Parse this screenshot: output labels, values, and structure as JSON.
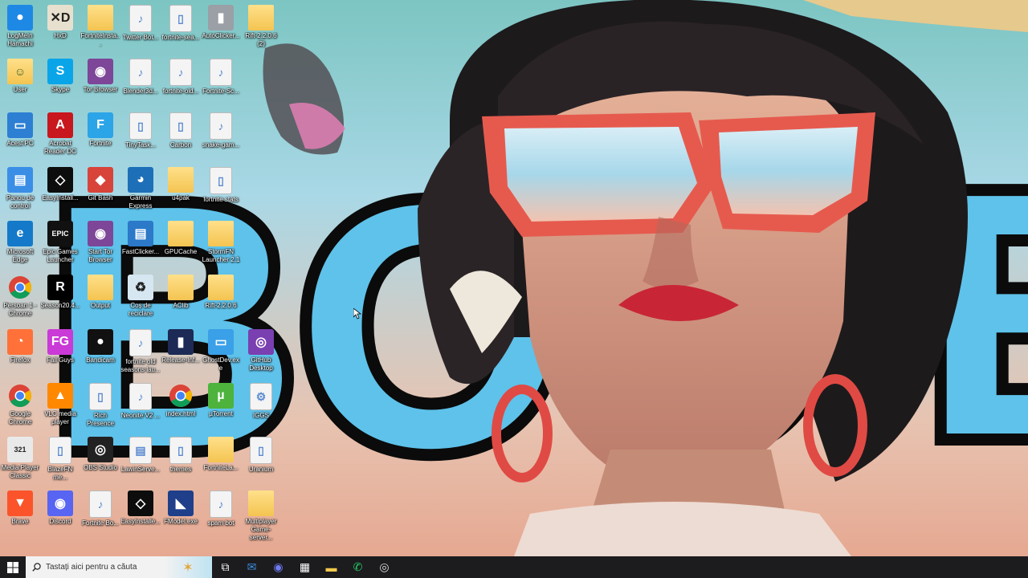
{
  "wallpaper": {
    "text_letters": "BOO",
    "text_letters_right": "E"
  },
  "desktop": {
    "icons": [
      {
        "label": "LogMeIn Hamachi",
        "icon": "logmein-hamachi-icon",
        "kind": "app",
        "color": "#1e88e5",
        "glyph": "●"
      },
      {
        "label": "HxD",
        "icon": "hxd-icon",
        "kind": "app",
        "color": "#e8e0cf",
        "glyph": "✕D"
      },
      {
        "label": "FortniteInsta...",
        "icon": "folder-icon",
        "kind": "folder",
        "glyph": ""
      },
      {
        "label": "Twitter Bot...",
        "icon": "document-icon",
        "kind": "doc",
        "glyph": "♪"
      },
      {
        "label": "fortnite-sea...",
        "icon": "document-icon",
        "kind": "doc",
        "glyph": "▯"
      },
      {
        "label": "AutoClicker...",
        "icon": "mouse-icon",
        "kind": "app",
        "color": "#9aa0a6",
        "glyph": "▮"
      },
      {
        "label": "Rift-2.2.0.6 (2)",
        "icon": "folder-icon",
        "kind": "folder",
        "glyph": ""
      },
      {
        "label": "User",
        "icon": "user-folder-icon",
        "kind": "folder",
        "glyph": "☺"
      },
      {
        "label": "Skype",
        "icon": "skype-icon",
        "kind": "app",
        "color": "#0aa5e8",
        "glyph": "S"
      },
      {
        "label": "Tor Browser",
        "icon": "tor-browser-icon",
        "kind": "app",
        "color": "#7d4698",
        "glyph": "◉"
      },
      {
        "label": "Blender3d...",
        "icon": "document-icon",
        "kind": "doc",
        "glyph": "♪"
      },
      {
        "label": "fortnite-old...",
        "icon": "document-icon",
        "kind": "doc",
        "glyph": "♪"
      },
      {
        "label": "Fortnite-Sc...",
        "icon": "document-icon",
        "kind": "doc",
        "glyph": "♪"
      },
      {
        "label": "Acest PC",
        "icon": "computer-icon",
        "kind": "app",
        "color": "#2d7fd3",
        "glyph": "▭"
      },
      {
        "label": "Acrobat Reader DC",
        "icon": "acrobat-reader-icon",
        "kind": "app",
        "color": "#c8171e",
        "glyph": "A"
      },
      {
        "label": "Fortnite",
        "icon": "fortnite-icon",
        "kind": "app",
        "color": "#2ba4e8",
        "glyph": "F"
      },
      {
        "label": "TinyTask...",
        "icon": "document-icon",
        "kind": "doc",
        "glyph": "▯"
      },
      {
        "label": "Carbon",
        "icon": "document-icon",
        "kind": "doc",
        "glyph": "▯"
      },
      {
        "label": "snake-gam...",
        "icon": "document-icon",
        "kind": "doc",
        "glyph": "♪"
      },
      {
        "label": "Panou de control",
        "icon": "control-panel-icon",
        "kind": "app",
        "color": "#3a8ee6",
        "glyph": "▤"
      },
      {
        "label": "EasyInstall...",
        "icon": "easyinstaller-icon",
        "kind": "app",
        "color": "#0d0d0d",
        "glyph": "◇"
      },
      {
        "label": "Git Bash",
        "icon": "git-bash-icon",
        "kind": "app",
        "color": "#d8443a",
        "glyph": "◆"
      },
      {
        "label": "Garmin Express",
        "icon": "garmin-express-icon",
        "kind": "app",
        "color": "#1d6fb8",
        "glyph": "◕"
      },
      {
        "label": "u4pak",
        "icon": "folder-icon",
        "kind": "folder",
        "glyph": ""
      },
      {
        "label": "fortnite stats",
        "icon": "document-icon",
        "kind": "doc",
        "glyph": "▯"
      },
      {
        "label": "Microsoft Edge",
        "icon": "edge-icon",
        "kind": "app",
        "color": "#1479c9",
        "glyph": "e"
      },
      {
        "label": "Epic Games Launcher",
        "icon": "epic-games-icon",
        "kind": "app",
        "color": "#111",
        "glyph": "EPIC"
      },
      {
        "label": "Start Tor Browser",
        "icon": "tor-browser-icon",
        "kind": "app",
        "color": "#7d4698",
        "glyph": "◉"
      },
      {
        "label": "FastClicker...",
        "icon": "fastclicker-icon",
        "kind": "app",
        "color": "#2b79c8",
        "glyph": "▤"
      },
      {
        "label": "GPUCache",
        "icon": "folder-icon",
        "kind": "folder",
        "glyph": ""
      },
      {
        "label": "StormFN Launcher 2.1",
        "icon": "folder-icon",
        "kind": "folder",
        "glyph": ""
      },
      {
        "label": "Persoan 1 - Chrome",
        "icon": "chrome-icon",
        "kind": "chrome",
        "glyph": ""
      },
      {
        "label": "Season20.4...",
        "icon": "season-icon",
        "kind": "app",
        "color": "#000",
        "glyph": "R"
      },
      {
        "label": "Output",
        "icon": "folder-icon",
        "kind": "folder",
        "glyph": ""
      },
      {
        "label": "Coș de reciclare",
        "icon": "recycle-bin-icon",
        "kind": "app",
        "color": "#d6e7f2",
        "glyph": "♻"
      },
      {
        "label": "AClib",
        "icon": "folder-icon",
        "kind": "folder",
        "glyph": ""
      },
      {
        "label": "Rift-2.2.0.6",
        "icon": "folder-icon",
        "kind": "folder",
        "glyph": ""
      },
      {
        "label": "Firefox",
        "icon": "firefox-icon",
        "kind": "app",
        "color": "#ff7139",
        "glyph": "◔"
      },
      {
        "label": "Fall Guys",
        "icon": "fall-guys-icon",
        "kind": "app",
        "color": "#c93ad6",
        "glyph": "FG"
      },
      {
        "label": "Bandicam",
        "icon": "bandicam-icon",
        "kind": "app",
        "color": "#111",
        "glyph": "●"
      },
      {
        "label": "fortnite old seasons lau...",
        "icon": "document-icon",
        "kind": "doc",
        "glyph": "♪"
      },
      {
        "label": "Release-Inf...",
        "icon": "release-icon",
        "kind": "app",
        "color": "#1c2a55",
        "glyph": "▮"
      },
      {
        "label": "GhostDev.exe",
        "icon": "ghostdev-icon",
        "kind": "app",
        "color": "#3aa0e8",
        "glyph": "▭"
      },
      {
        "label": "GitHub Desktop",
        "icon": "github-desktop-icon",
        "kind": "app",
        "color": "#7a3fb0",
        "glyph": "◎"
      },
      {
        "label": "Google Chrome",
        "icon": "chrome-icon",
        "kind": "chrome",
        "glyph": ""
      },
      {
        "label": "VLC media player",
        "icon": "vlc-icon",
        "kind": "app",
        "color": "#ff8800",
        "glyph": "▲"
      },
      {
        "label": "Rich Presence",
        "icon": "document-icon",
        "kind": "doc",
        "glyph": "▯"
      },
      {
        "label": "Neonite V2 ...",
        "icon": "document-icon",
        "kind": "doc",
        "glyph": "♪"
      },
      {
        "label": "index.html",
        "icon": "chrome-icon",
        "kind": "chrome",
        "glyph": ""
      },
      {
        "label": "µTorrent",
        "icon": "utorrent-icon",
        "kind": "app",
        "color": "#4db33d",
        "glyph": "µ"
      },
      {
        "label": "IGGS",
        "icon": "document-icon",
        "kind": "doc",
        "glyph": "⚙"
      },
      {
        "label": "Media Player Classic",
        "icon": "media-player-classic-icon",
        "kind": "app",
        "color": "#e9e9e9",
        "glyph": "321"
      },
      {
        "label": "BlazeFN me...",
        "icon": "document-icon",
        "kind": "doc",
        "glyph": "▯"
      },
      {
        "label": "OBS Studio",
        "icon": "obs-studio-icon",
        "kind": "app",
        "color": "#222",
        "glyph": "◎"
      },
      {
        "label": "LawinServe...",
        "icon": "document-icon",
        "kind": "doc",
        "glyph": "▤"
      },
      {
        "label": "themes",
        "icon": "document-icon",
        "kind": "doc",
        "glyph": "▯"
      },
      {
        "label": "FortniteLa...",
        "icon": "folder-icon",
        "kind": "folder",
        "glyph": ""
      },
      {
        "label": "Uranium",
        "icon": "document-icon",
        "kind": "doc",
        "glyph": "▯"
      },
      {
        "label": "Brave",
        "icon": "brave-icon",
        "kind": "app",
        "color": "#fb542b",
        "glyph": "▼"
      },
      {
        "label": "Discord",
        "icon": "discord-icon",
        "kind": "app",
        "color": "#5865f2",
        "glyph": "◉"
      },
      {
        "label": "Fortnite Bo...",
        "icon": "document-icon",
        "kind": "doc",
        "glyph": "♪"
      },
      {
        "label": "EasyInstalle...",
        "icon": "easyinstaller-icon",
        "kind": "app",
        "color": "#0d0d0d",
        "glyph": "◇"
      },
      {
        "label": "FModel.exe",
        "icon": "fmodel-icon",
        "kind": "app",
        "color": "#1f3f8a",
        "glyph": "◣"
      },
      {
        "label": "spam bot",
        "icon": "document-icon",
        "kind": "doc",
        "glyph": "♪"
      },
      {
        "label": "Multiplayer Game-server...",
        "icon": "folder-icon",
        "kind": "folder",
        "glyph": ""
      }
    ]
  },
  "taskbar": {
    "search_placeholder": "Tastați aici pentru a căuta",
    "items": [
      {
        "name": "task-view-icon",
        "glyph": "⧉",
        "color": "#fff"
      },
      {
        "name": "mail-icon",
        "glyph": "✉",
        "color": "#3b8ee0"
      },
      {
        "name": "discord-taskbar-icon",
        "glyph": "◉",
        "color": "#6f7cf5"
      },
      {
        "name": "store-icon",
        "glyph": "▦",
        "color": "#fff"
      },
      {
        "name": "file-explorer-icon",
        "glyph": "▬",
        "color": "#f2c94c"
      },
      {
        "name": "whatsapp-icon",
        "glyph": "✆",
        "color": "#25d366"
      },
      {
        "name": "obs-taskbar-icon",
        "glyph": "◎",
        "color": "#ddd"
      }
    ]
  }
}
